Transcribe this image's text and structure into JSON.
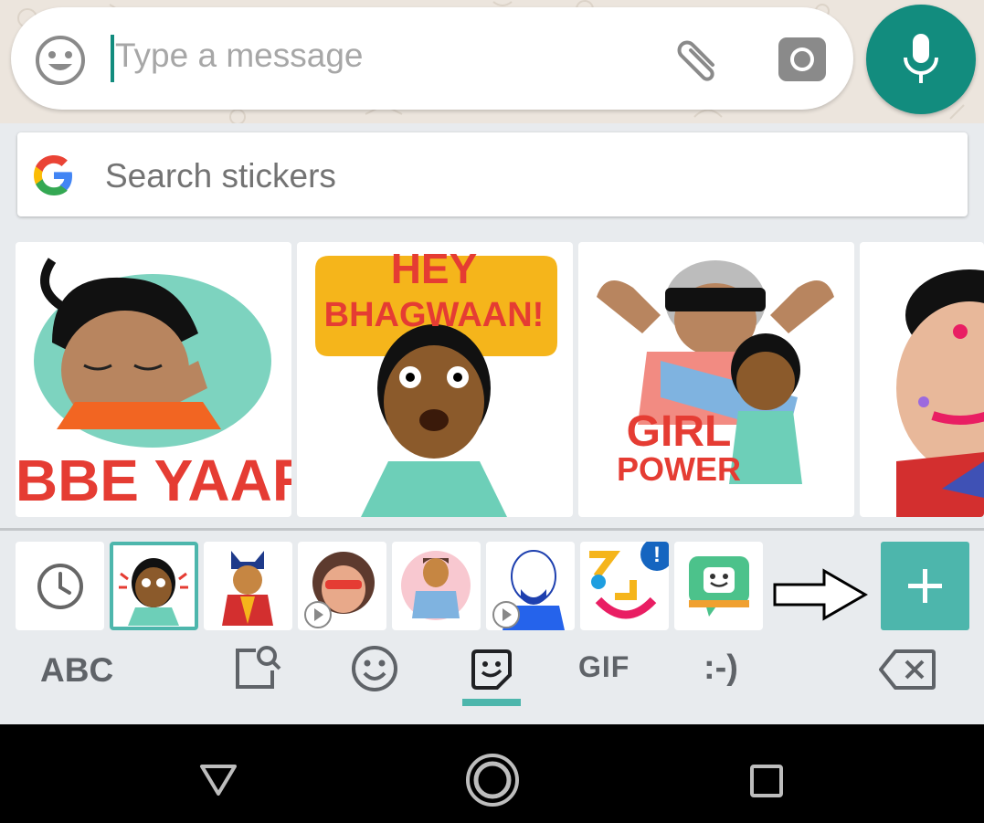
{
  "composer": {
    "placeholder": "Type a message",
    "icons": [
      "emoji-icon",
      "paperclip-icon",
      "camera-icon",
      "mic-icon"
    ]
  },
  "search": {
    "placeholder": "Search stickers",
    "icon": "google-g-icon"
  },
  "stickers": [
    {
      "text": "ABBE YAAR!"
    },
    {
      "text_line1": "HEY",
      "text_line2": "BHAGWAAN!"
    },
    {
      "text_line1": "GIRL",
      "text_line2": "POWER"
    },
    {
      "text": ""
    }
  ],
  "tray": {
    "items": [
      "recent-icon",
      "sticker-pack-hey",
      "sticker-pack-royal",
      "sticker-pack-woman",
      "sticker-pack-man",
      "sticker-pack-bald",
      "sticker-pack-new",
      "bitmoji-icon"
    ],
    "add_icon": "plus-icon"
  },
  "bottom_nav": {
    "abc": "ABC",
    "gif": "GIF",
    "emoticon": ":-)"
  },
  "colors": {
    "accent": "#4db6ac",
    "whatsapp_green": "#128c7e",
    "sticker_red": "#e53c33"
  }
}
